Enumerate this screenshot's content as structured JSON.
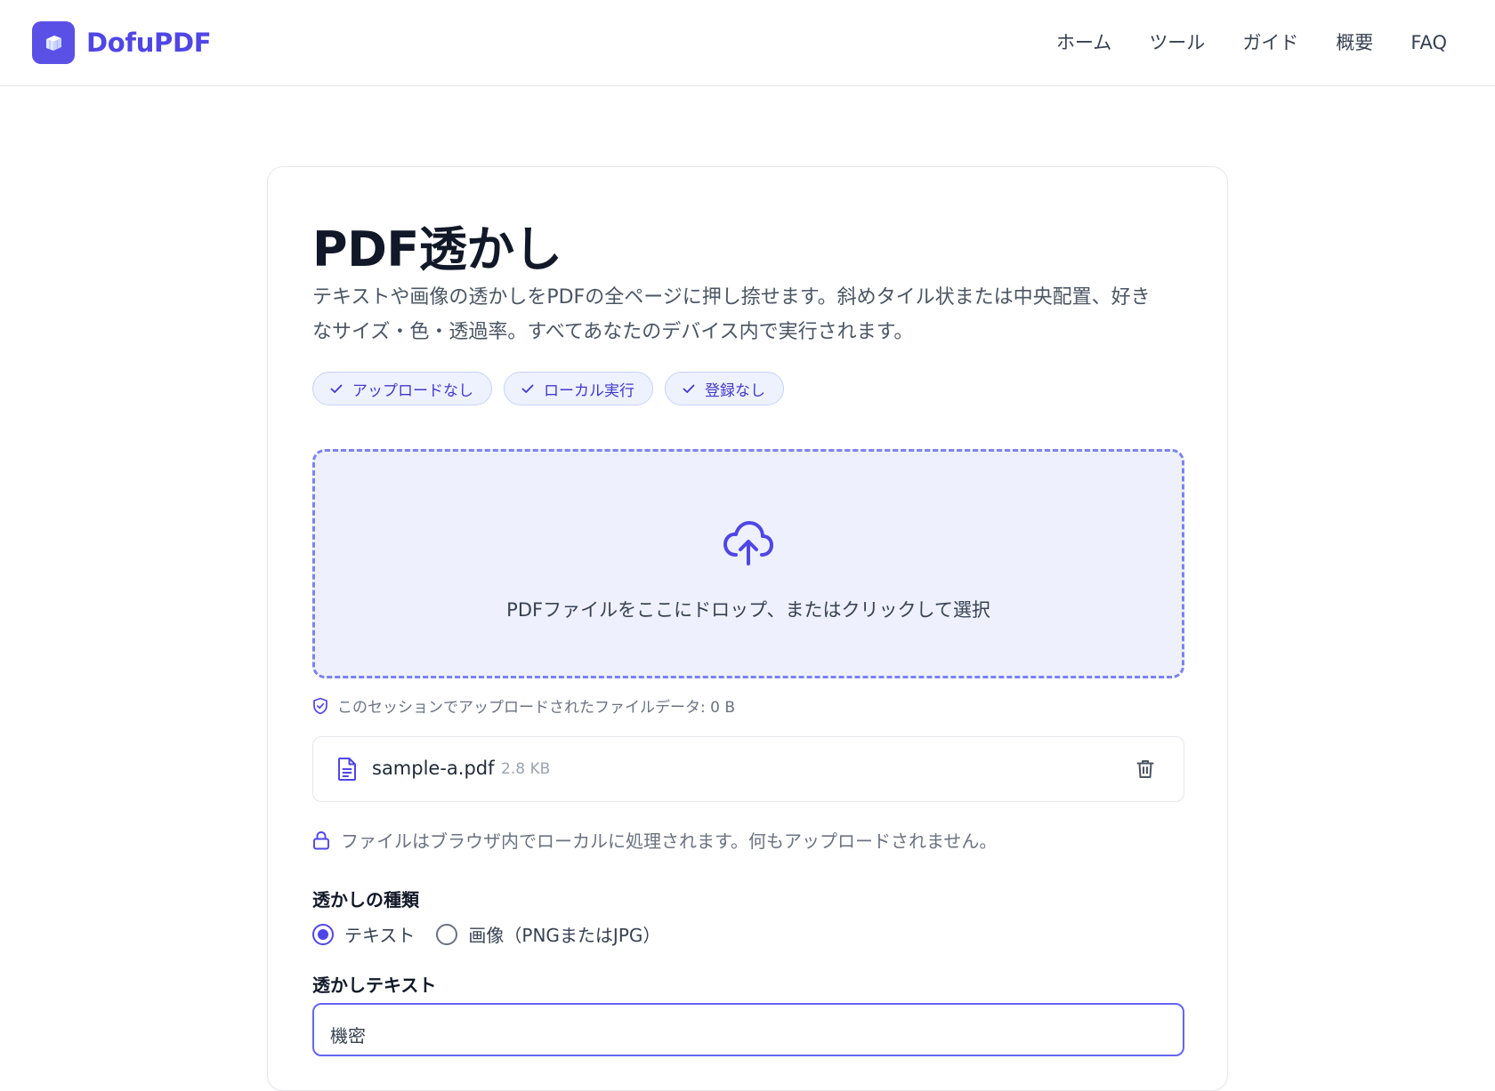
{
  "brand": {
    "name": "DofuPDF",
    "accent": "#4f46e5"
  },
  "nav": {
    "items": [
      "ホーム",
      "ツール",
      "ガイド",
      "概要",
      "FAQ"
    ]
  },
  "page": {
    "title": "PDF透かし",
    "description": "テキストや画像の透かしをPDFの全ページに押し捺せます。斜めタイル状または中央配置、好きなサイズ・色・透過率。すべてあなたのデバイス内で実行されます。",
    "badges": [
      "アップロードなし",
      "ローカル実行",
      "登録なし"
    ]
  },
  "dropzone": {
    "text": "PDFファイルをここにドロップ、またはクリックして選択"
  },
  "session_note": "このセッションでアップロードされたファイルデータ: 0 B",
  "file": {
    "name": "sample-a.pdf",
    "size": "2.8 KB"
  },
  "local_note": "ファイルはブラウザ内でローカルに処理されます。何もアップロードされません。",
  "watermark_type": {
    "label": "透かしの種類",
    "options": [
      "テキスト",
      "画像（PNGまたはJPG）"
    ],
    "selected": "テキスト"
  },
  "watermark_text": {
    "label": "透かしテキスト",
    "value": "機密"
  }
}
